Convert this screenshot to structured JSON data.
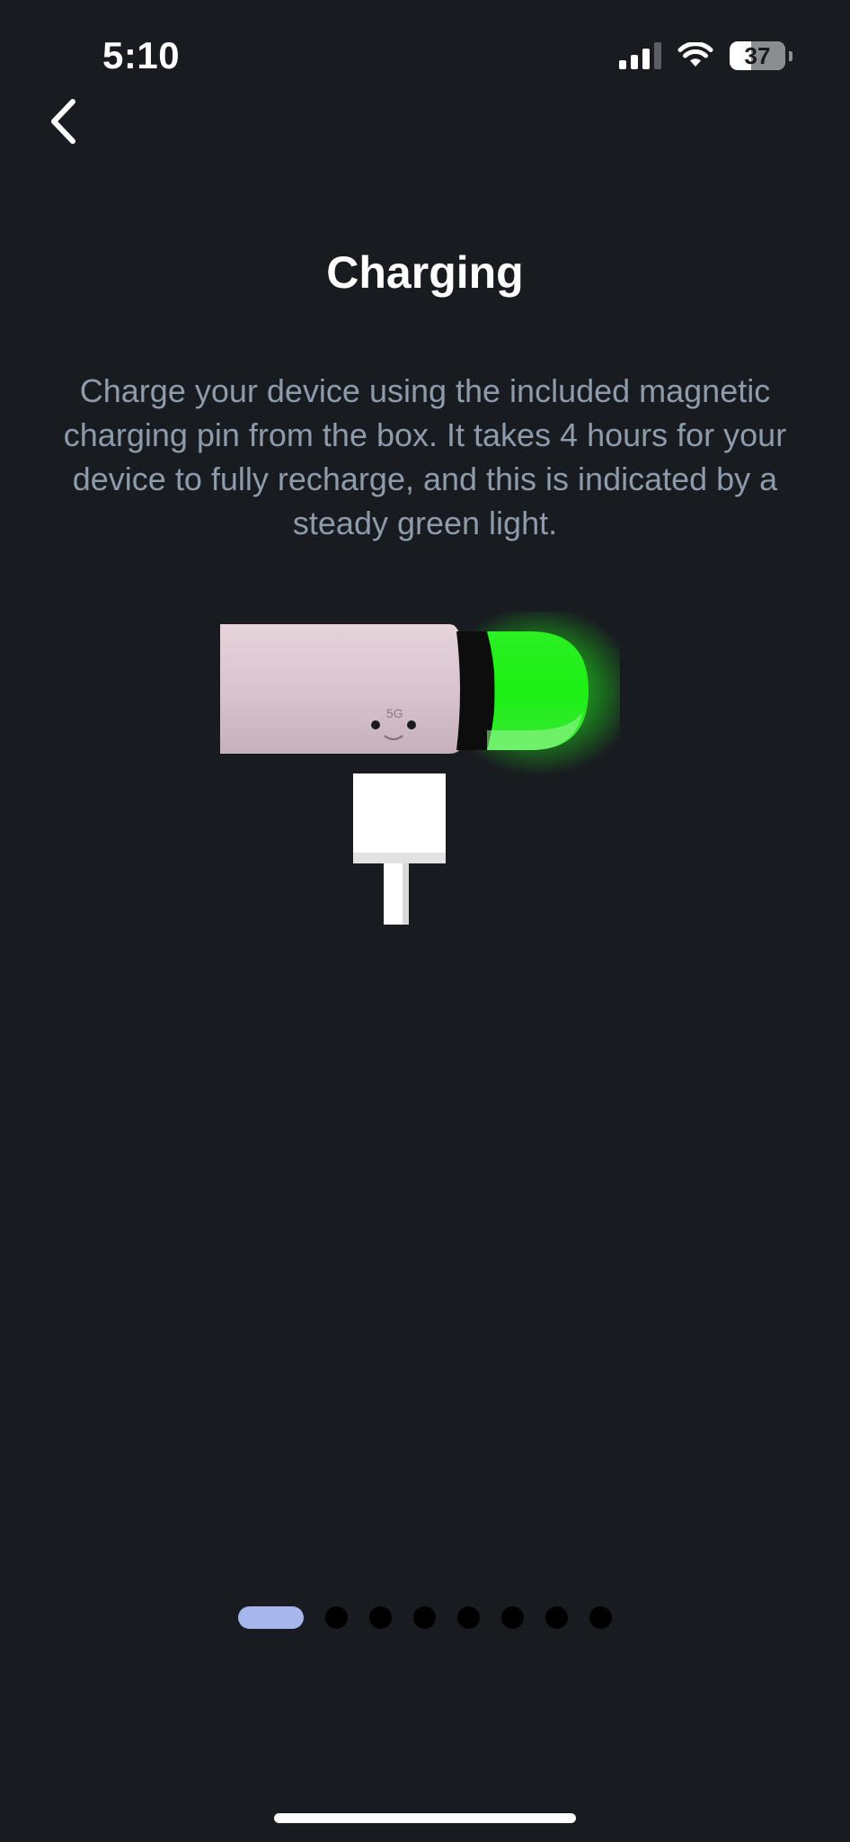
{
  "status_bar": {
    "time": "5:10",
    "battery_level": "37",
    "icons": [
      "cellular-signal-icon",
      "wifi-icon",
      "battery-icon"
    ]
  },
  "navigation": {
    "back_icon": "chevron-left-icon"
  },
  "page": {
    "title": "Charging",
    "description": "Charge your device using the included magnetic charging pin from the box. It takes 4 hours for your device to fully recharge, and this is indicated by a steady green light."
  },
  "illustration": {
    "device_color": "#ddc9d3",
    "light_color": "#23f21a",
    "charger_color": "#ffffff"
  },
  "pagination": {
    "total_pages": 8,
    "current_page": 1,
    "active_color": "#a7b6ec"
  },
  "colors": {
    "background": "#181b20",
    "title": "#ffffff",
    "description": "#8d9bab"
  }
}
